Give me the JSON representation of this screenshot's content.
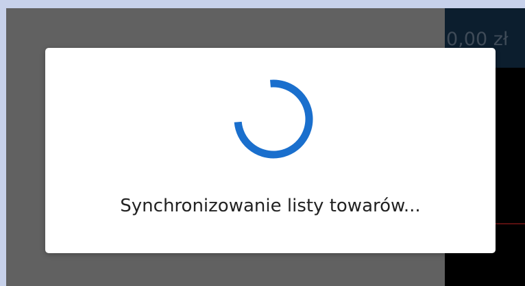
{
  "background_panel": {
    "total_amount": "0,00 zł"
  },
  "dialog": {
    "message": "Synchronizowanie listy towarów...",
    "spinner_icon": "progress-spinner-icon",
    "spinner_color": "#1a6fcd"
  }
}
